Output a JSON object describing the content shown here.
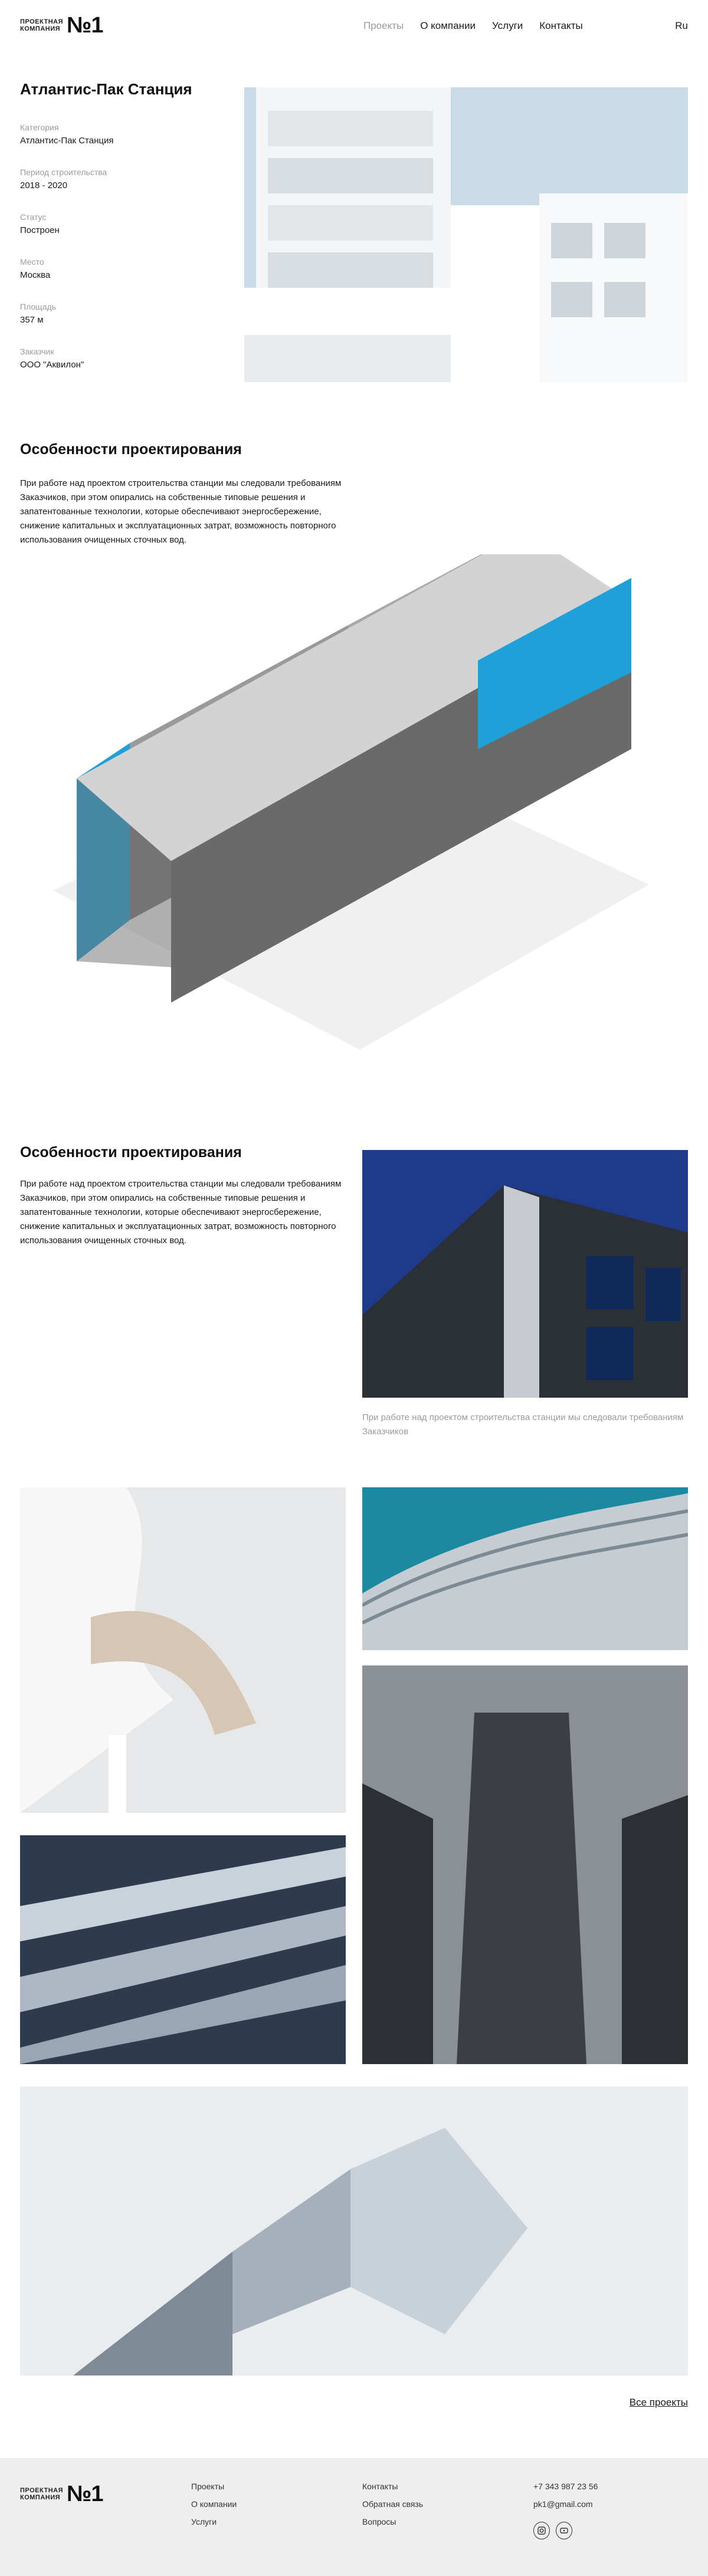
{
  "header": {
    "logo_text_line1": "Проектная",
    "logo_text_line2": "компания",
    "logo_number": "№1",
    "nav": [
      {
        "label": "Проекты",
        "active": true
      },
      {
        "label": "О компании",
        "active": false
      },
      {
        "label": "Услуги",
        "active": false
      },
      {
        "label": "Контакты",
        "active": false
      }
    ],
    "lang": "Ru"
  },
  "project": {
    "title": "Атлантис-Пак Станция",
    "meta": [
      {
        "label": "Категория",
        "value": "Атлантис-Пак Станция"
      },
      {
        "label": "Период строительства",
        "value": "2018 - 2020"
      },
      {
        "label": "Статус",
        "value": "Построен"
      },
      {
        "label": "Место",
        "value": "Москва"
      },
      {
        "label": "Площадь",
        "value": "357 м"
      },
      {
        "label": "Заказчик",
        "value": "ООО \"Аквилон\""
      }
    ]
  },
  "section1": {
    "title": "Особенности проектирования",
    "text": "При работе над проектом строительства станции мы следовали требованиям Заказчиков, при этом опирались на собственные типовые решения и запатентованные технологии, которые обеспечивают энергосбережение, снижение капитальных и эксплуатационных затрат, возможность повторного использования очищенных сточных вод."
  },
  "section2": {
    "title": "Особенности проектирования",
    "text": "При работе над проектом строительства станции мы следовали требованиям Заказчиков, при этом опирались на собственные типовые решения и запатентованные технологии, которые обеспечивают энергосбережение, снижение капитальных и эксплуатационных затрат, возможность повторного использования очищенных сточных вод.",
    "caption": "При работе над проектом строительства станции мы следовали требованиям Заказчиков"
  },
  "all_projects": "Все проекты",
  "footer": {
    "logo_text_line1": "Проектная",
    "logo_text_line2": "компания",
    "logo_number": "№1",
    "col1": [
      "Проекты",
      "О компании",
      "Услуги"
    ],
    "col2": [
      "Контакты",
      "Обратная связь",
      "Вопросы"
    ],
    "phone": "+7 343 987 23 56",
    "email": "pk1@gmail.com",
    "social_icons": [
      "instagram-icon",
      "youtube-icon"
    ]
  },
  "colors": {
    "accent_blue": "#1fa0d8",
    "sky": "#c9dbe6",
    "footer_bg": "#eeeeee",
    "muted_text": "#9b9b9b"
  }
}
